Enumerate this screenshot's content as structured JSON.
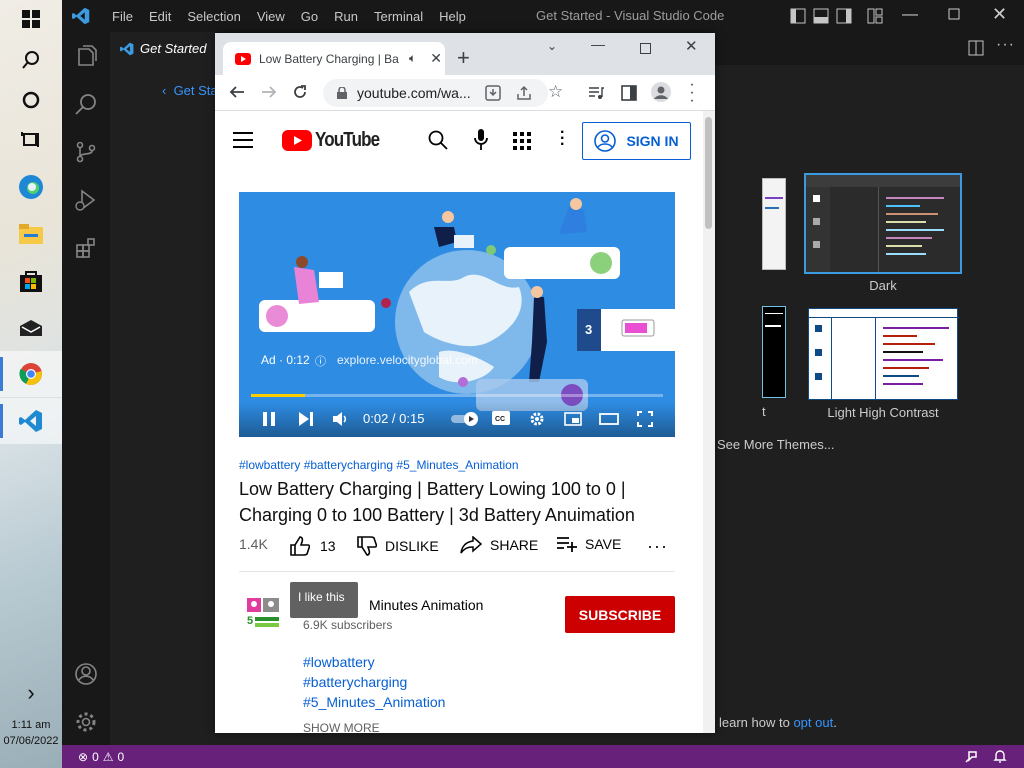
{
  "taskbar": {
    "time": "1:11 am",
    "date": "07/06/2022",
    "icons": [
      "windows-icon",
      "search-icon",
      "cortana-icon",
      "task-view-icon",
      "edge-icon",
      "file-explorer-icon",
      "store-icon",
      "mail-icon",
      "chrome-icon",
      "vscode-icon"
    ],
    "chevron": "›"
  },
  "vscode": {
    "menu": [
      "File",
      "Edit",
      "Selection",
      "View",
      "Go",
      "Run",
      "Terminal",
      "Help"
    ],
    "title": "Get Started - Visual Studio Code",
    "tab": "Get Started",
    "back_link": "Get Sta",
    "themes": {
      "dark": "Dark",
      "light_hc": "Light High Contrast",
      "partial_label": "t",
      "see_more": "See More Themes..."
    },
    "footer_text": "learn how to",
    "footer_link": "opt out",
    "footer_end": ".",
    "status": {
      "errors": "0",
      "warnings": "0"
    },
    "accent": "#68217a"
  },
  "chrome": {
    "tab_title": "Low Battery Charging | Ba",
    "url": "youtube.com/wa...",
    "new_tab": "+"
  },
  "youtube": {
    "logo": "YouTube",
    "sign_in": "SIGN IN",
    "ad": {
      "label": "Ad · 0:12",
      "domain": "explore.velocityglobal.com",
      "count": "3"
    },
    "player": {
      "time": "0:02 / 0:15",
      "progress": 0.13
    },
    "hashtags_line": "#lowbattery #batterycharging #5_Minutes_Animation",
    "title_line1": "Low Battery Charging | Battery Lowing 100 to 0 |",
    "title_line2": "Charging 0 to 100 Battery | 3d Battery Anuimation",
    "views": "1.4K",
    "likes": "13",
    "dislike": "DISLIKE",
    "share": "SHARE",
    "save": "SAVE",
    "tooltip": "I like this",
    "channel": "5 Minutes Animation",
    "channel_visible": "Minutes Animation",
    "subscribers": "6.9K subscribers",
    "subscribe": "SUBSCRIBE",
    "tags": [
      "#lowbattery",
      "#batterycharging",
      "#5_Minutes_Animation"
    ],
    "show_more": "SHOW MORE",
    "red": "#cc0000",
    "blue": "#065fd4"
  }
}
